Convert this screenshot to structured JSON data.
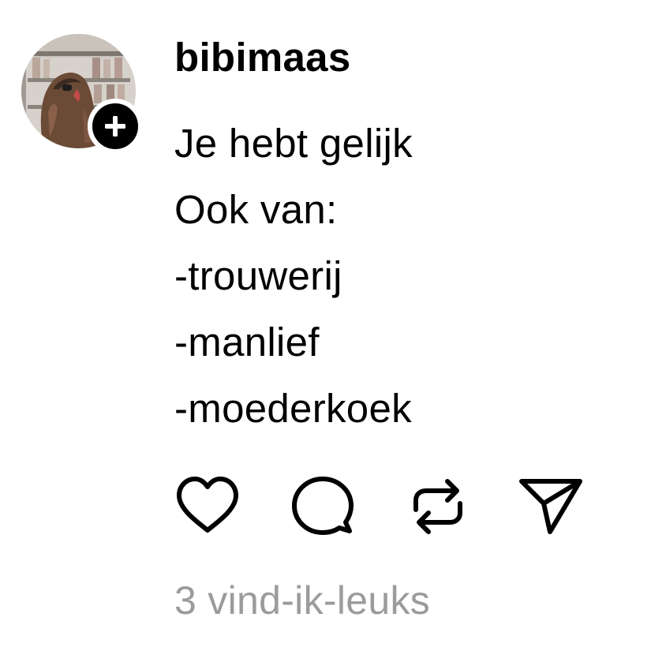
{
  "post": {
    "author": {
      "username": "bibimaas",
      "follow_icon": "plus-icon"
    },
    "text_lines": [
      "Je hebt gelijk",
      "Ook van:",
      "-trouwerij",
      "-manlief",
      "-moederkoek"
    ],
    "actions": [
      {
        "name": "like",
        "icon": "heart-icon"
      },
      {
        "name": "reply",
        "icon": "comment-icon"
      },
      {
        "name": "repost",
        "icon": "repost-icon"
      },
      {
        "name": "share",
        "icon": "send-icon"
      }
    ],
    "likes_label": "3 vind-ik-leuks"
  },
  "colors": {
    "text": "#000000",
    "secondary_text": "#9b9b9b",
    "background": "#ffffff"
  }
}
